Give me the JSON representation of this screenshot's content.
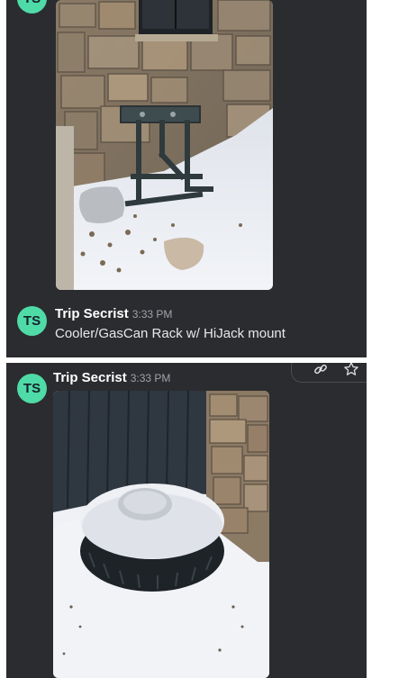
{
  "messages": [
    {
      "avatar_initials": "TS",
      "author": "Trip Secrist",
      "time": "3:33 PM",
      "text": "Cooler/GasCan Rack w/ HiJack mount"
    },
    {
      "avatar_initials": "TS",
      "author": "Trip Secrist",
      "time": "3:33 PM"
    }
  ],
  "icons": {
    "toolbar": [
      "link-icon",
      "star-icon"
    ]
  },
  "colors": {
    "background": "#2b2c2f",
    "avatar": "#4fdba7",
    "timestamp": "#9ea3ab"
  }
}
